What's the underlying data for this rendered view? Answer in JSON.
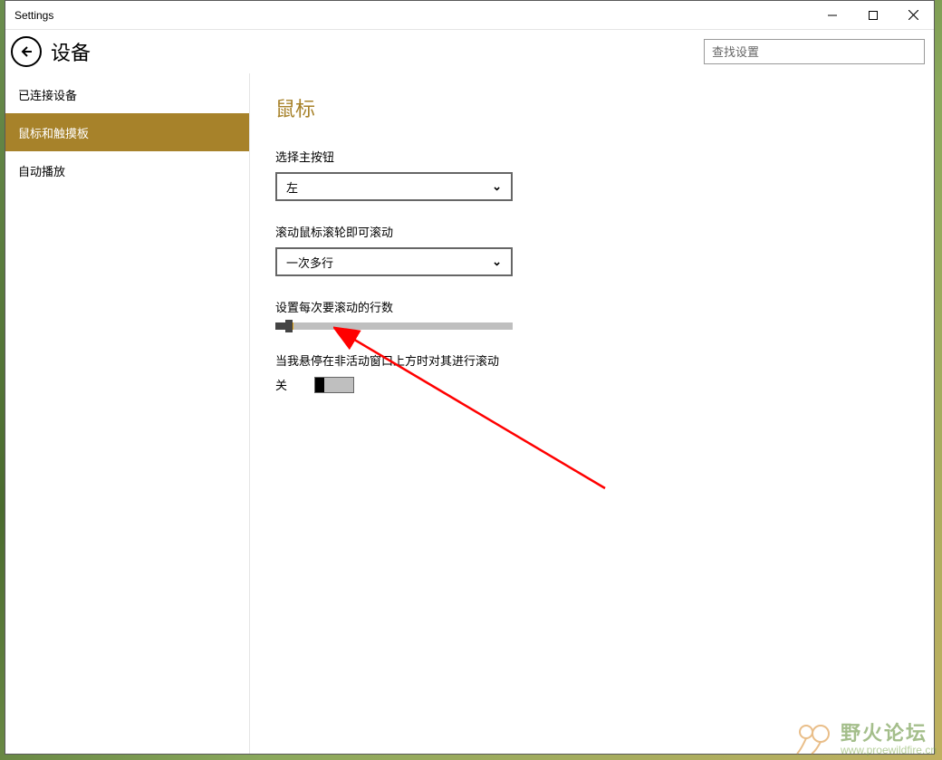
{
  "window": {
    "title": "Settings"
  },
  "header": {
    "section_title": "设备",
    "search_placeholder": "查找设置"
  },
  "sidebar": {
    "items": [
      {
        "label": "已连接设备",
        "active": false
      },
      {
        "label": "鼠标和触摸板",
        "active": true
      },
      {
        "label": "自动播放",
        "active": false
      }
    ]
  },
  "page": {
    "title": "鼠标",
    "primary_button_label": "选择主按钮",
    "primary_button_value": "左",
    "scroll_wheel_label": "滚动鼠标滚轮即可滚动",
    "scroll_wheel_value": "一次多行",
    "lines_to_scroll_label": "设置每次要滚动的行数",
    "inactive_window_label": "当我悬停在非活动窗口上方时对其进行滚动",
    "inactive_window_state": "关"
  },
  "watermark": {
    "name": "野火论坛",
    "url": "www.proewildfire.cn"
  }
}
